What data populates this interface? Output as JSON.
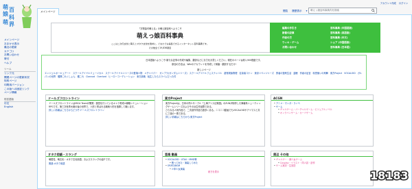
{
  "sidebar": {
    "logo_text": "萌娘百科",
    "nav_items": [
      "メインページ",
      "おまかせ表示",
      "最近の更新",
      "カテゴリ",
      "お問い合わせ",
      "寄付",
      "ヘルプ"
    ],
    "tools_header": "ツール",
    "tools_items": [
      "リンク元",
      "関連ページの更新状況",
      "特別ページ",
      "印刷用バージョン",
      "この版への固定リンク",
      "ページ情報"
    ],
    "lang_header": "他言語版",
    "lang_items": [
      "中文",
      "English"
    ]
  },
  "personal": {
    "items": [
      "アカウント作成",
      "ログイン"
    ]
  },
  "tabs": {
    "main_page": "メインページ",
    "read": "閲覧",
    "history": "履歴表示",
    "more": "▾"
  },
  "search": {
    "placeholder": "萌えっ娘百科事典内を検索"
  },
  "header": {
    "welcome": "「万物皆可萌える」の萌え娘百科へようこそ",
    "title": "萌えっ娘百科事典",
    "description": "ここは二次元文化と萌えとオタク文化を題材に、どなたでも編集できるインターネット百科事典です。",
    "count": "その他全て19,836項目"
  },
  "green_panel": {
    "col1": [
      "編集の手引き",
      "新着の記事",
      "作者の方",
      "ウィキ・ゲーム",
      "お問い合わせ"
    ],
    "col2": [
      "百科事典 (中国語版)",
      "百科事典 (英語版)",
      "百科事典 (中文)",
      "シェア (中国語版)",
      "百科事典 (日本語)"
    ]
  },
  "notice": {
    "line1": "日本語版へようこそ!新たな記事の作成や編集、翻訳などにお力をお貸しください。現在のページは約1,900程度です。",
    "line2": "参加の方法は、Wikiのアカウントを作成して執筆・翻訳するだけ!",
    "new_pages_title": "新しいページ",
    "new_pages": [
      "エンジェルポーキュアート",
      "スクールアイドルミュージカル",
      "スクールアイドルシリーズの登場人物",
      "メチャイパー",
      "ガンプラ(ガンダムシリーズ)",
      "スクールアイドルフェスティバル",
      "超常現象物理",
      "名探偵コナン",
      "東京リベンジャーズ",
      "勇者の聖剣生活",
      "盗聴",
      "作者の証言",
      "精霊使いの剣舞",
      "東方Project",
      "VOCALOID",
      "ガルパンの世界",
      "艦隊これくしょん",
      "艦これ",
      "Clannad",
      "Overlord",
      "ヒーローコーデレーション",
      "東方辞典",
      "転生したらスライムだった件"
    ]
  },
  "portals": {
    "doll": {
      "title": "ドールズフロントライン",
      "body": [
        "ドールズフロントラインはMICA Teamが開発・運営を行っているキャラ育成×戦略シミュレーションRPGです。第三次世界大戦の後の世界で、人形と呼ばれる戦術人形を指揮して戦います。",
        "詳しい情報はこちらからどうぞ:ドールズフロントライン"
      ]
    },
    "touhou": {
      "title": "東方Project",
      "body": [
        "東方Projectは、日本の同人サークル「上海アリス幻樂団」のZUNが制作した弾幕系シューティングゲームシリーズおよびその派生作品群である。",
        "さらなる人気作品で、二次創作作品も数多くある。ニコニコ動画でもVOCALOIDやアイマスと共に三強の一角である。",
        "詳しい情報はこちらから:東方Project"
      ]
    },
    "acgn": {
      "title": "ACGN",
      "items": [
        "アニメ・マンガ・ラノベ",
        "ゲーム",
        "ギャルゲーム・バーチャルゲーム・ビジュアルノベル",
        "オンラインゲーム・カードゲーム"
      ]
    },
    "otaku": {
      "title": "オタク用語・スラング",
      "body": [
        "萌属性、萌文化・オタク文化用語、およびスラングの紹介です。",
        "関連:オタク用語"
      ]
    },
    "music": {
      "title": "音楽 動画",
      "items": [
        "VOCALOID・UTAU・MMD等",
        "歌ってみた・演奏してみた",
        "OP/ED/BGM"
      ],
      "sub": "少年少女演奏",
      "more": "続きを表示"
    },
    "mix": {
      "title": "周辺 その他",
      "items": [
        "ギャルゲー・美少女ゲーム",
        "Cosplay・イラスト・同人誌・創作",
        "ゲーム実況・生放送"
      ]
    }
  },
  "watermark": {
    "text": "18183"
  }
}
